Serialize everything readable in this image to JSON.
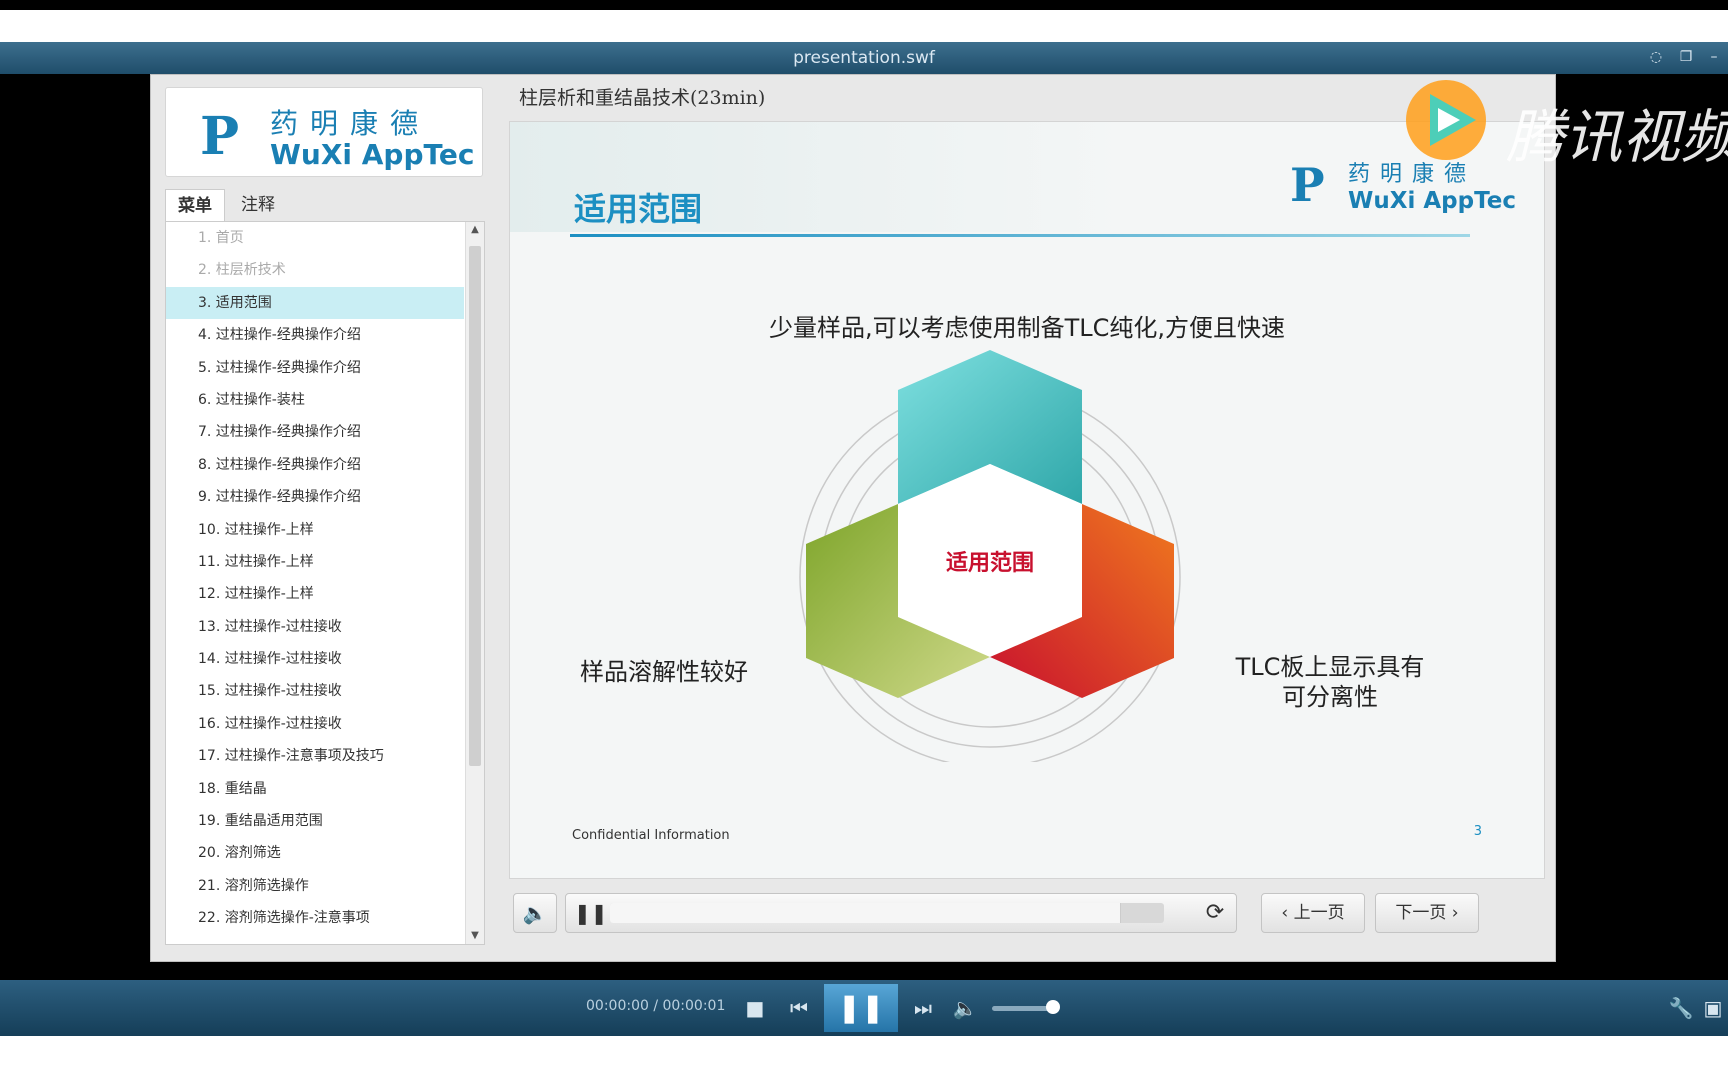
{
  "window": {
    "title": "presentation.swf"
  },
  "sidebar": {
    "logo": {
      "mark": "P",
      "cn": "药明康德",
      "en": "WuXi AppTec"
    },
    "tabs": [
      {
        "label": "菜单"
      },
      {
        "label": "注释"
      }
    ],
    "menu_items": [
      {
        "label": "1. 首页"
      },
      {
        "label": "2. 柱层析技术"
      },
      {
        "label": "3. 适用范围"
      },
      {
        "label": "4. 过柱操作-经典操作介绍"
      },
      {
        "label": "5. 过柱操作-经典操作介绍"
      },
      {
        "label": "6. 过柱操作-装柱"
      },
      {
        "label": "7. 过柱操作-经典操作介绍"
      },
      {
        "label": "8. 过柱操作-经典操作介绍"
      },
      {
        "label": "9. 过柱操作-经典操作介绍"
      },
      {
        "label": "10. 过柱操作-上样"
      },
      {
        "label": "11. 过柱操作-上样"
      },
      {
        "label": "12. 过柱操作-上样"
      },
      {
        "label": "13. 过柱操作-过柱接收"
      },
      {
        "label": "14. 过柱操作-过柱接收"
      },
      {
        "label": "15. 过柱操作-过柱接收"
      },
      {
        "label": "16. 过柱操作-过柱接收"
      },
      {
        "label": "17. 过柱操作-注意事项及技巧"
      },
      {
        "label": "18. 重结晶"
      },
      {
        "label": "19. 重结晶适用范围"
      },
      {
        "label": "20. 溶剂筛选"
      },
      {
        "label": "21. 溶剂筛选操作"
      },
      {
        "label": "22. 溶剂筛选操作-注意事项"
      }
    ],
    "selected_index": 2
  },
  "slide": {
    "course_title": "柱层析和重结晶技术(23min)",
    "heading": "适用范围",
    "logo": {
      "mark": "P",
      "cn": "药明康德",
      "en": "WuXi AppTec"
    },
    "subtitle": "少量样品,可以考虑使用制备TLC纯化,方便且快速",
    "center_label": "适用范围",
    "label_left": "样品溶解性较好",
    "label_right": "TLC板上显示具有可分离性",
    "confidential": "Confidential Information",
    "page_number": "3",
    "colors": {
      "teal": "#3fc6c6",
      "green": "#8fb23a",
      "red": "#d9472a",
      "accent": "#1c8fc2"
    }
  },
  "controls": {
    "mute_icon": "speaker-icon",
    "pause_icon": "pause-icon",
    "progress": 0.92,
    "replay_icon": "replay-icon",
    "prev_label": "‹ 上一页",
    "next_label": "下一页 ›"
  },
  "watermark": {
    "text": "腾讯视频"
  },
  "player": {
    "timecode": "00:00:00 / 00:00:01",
    "volume": 0.85
  }
}
